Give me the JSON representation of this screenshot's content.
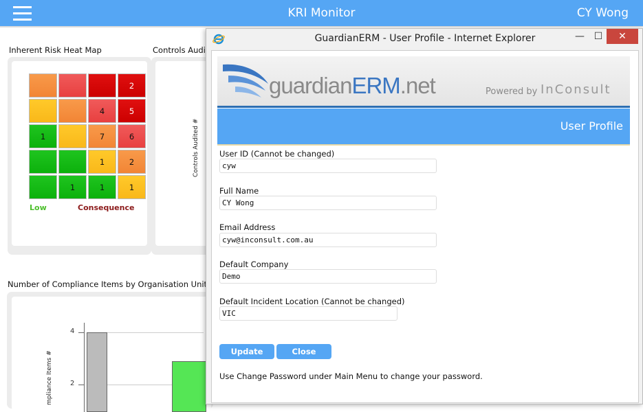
{
  "header": {
    "title": "KRI Monitor",
    "user": "CY Wong"
  },
  "panels": {
    "heatmap_title": "Inherent Risk Heat Map",
    "controls_title": "Controls Audit",
    "controls_axis_label": "Controls Audited #",
    "compliance_title": "Number of Compliance Items by Organisation Units",
    "compliance_axis_label": "mpliance Items #"
  },
  "heatmap": {
    "rows": [
      [
        "",
        "",
        "",
        "2"
      ],
      [
        "",
        "",
        "4",
        "5"
      ],
      [
        "1",
        "",
        "7",
        "6"
      ],
      [
        "",
        "",
        "1",
        "2"
      ],
      [
        "",
        "1",
        "1",
        "1"
      ]
    ],
    "colors": [
      [
        "o",
        "r-mid",
        "r-dark",
        "r-dark"
      ],
      [
        "y",
        "o",
        "r-mid",
        "r-dark"
      ],
      [
        "g",
        "y",
        "o",
        "r-mid"
      ],
      [
        "g",
        "g",
        "y",
        "o"
      ],
      [
        "g",
        "g",
        "g",
        "y"
      ]
    ],
    "legend_low": "Low",
    "legend_consequence": "Consequence"
  },
  "chart_data": {
    "type": "bar",
    "title": "Number of Compliance Items by Organisation Units",
    "ylabel": "mpliance Items #",
    "yticks": [
      4,
      2
    ],
    "series": [
      {
        "values": [
          4,
          2.9
        ]
      }
    ],
    "colors": [
      "#bbbbbb",
      "#55e655"
    ]
  },
  "ie_window": {
    "title": "GuardianERM - User Profile - Internet Explorer",
    "min_label": "—",
    "max_label": "☐",
    "close_label": "✕"
  },
  "profile": {
    "logo_main": "guardian",
    "logo_erm": "ERM",
    "logo_tld": ".net",
    "powered_by": "Powered by",
    "inconsult": "InConsult",
    "section_title": "User Profile",
    "fields": [
      {
        "label": "User ID (Cannot be changed)",
        "value": "cyw"
      },
      {
        "label": "Full Name",
        "value": "CY Wong"
      },
      {
        "label": "Email Address",
        "value": "cyw@inconsult.com.au"
      },
      {
        "label": "Default Company",
        "value": "Demo"
      },
      {
        "label": "Default Incident Location (Cannot be changed)",
        "value": "VIC"
      }
    ],
    "update_label": "Update",
    "close_label": "Close",
    "note": "Use Change Password under Main Menu to change your password."
  }
}
